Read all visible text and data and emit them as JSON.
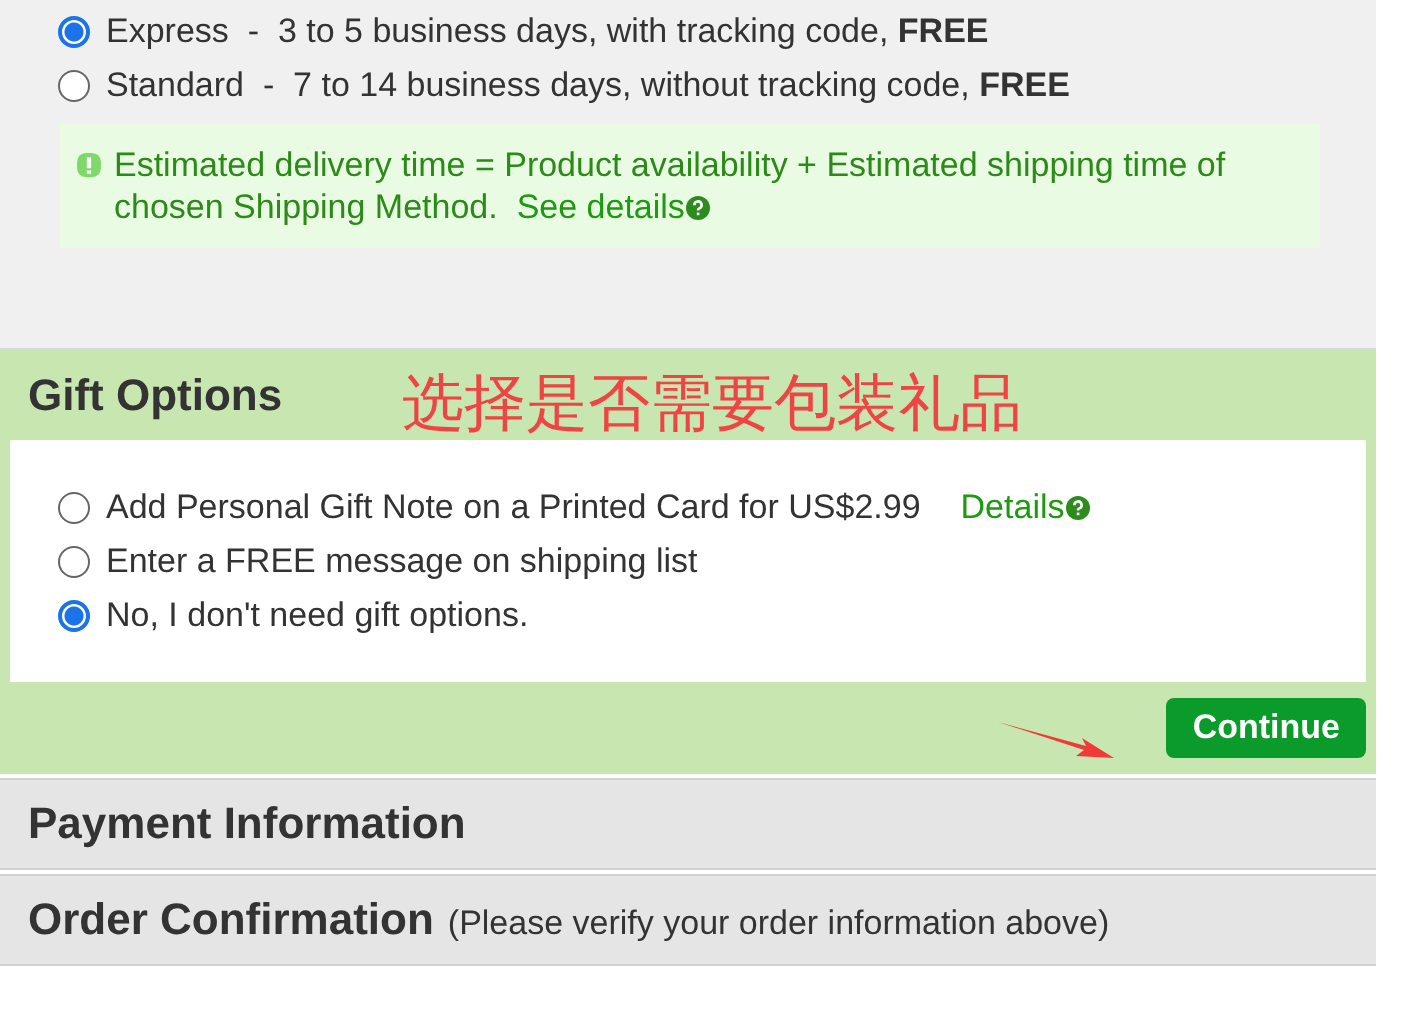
{
  "shipping_methods": [
    {
      "text": "Express  -  3 to 5 business days, with tracking code, **FREE**",
      "selected": true
    },
    {
      "text": "Standard  -  7 to 14 business days, without tracking code, **FREE**",
      "selected": false
    }
  ],
  "shipping_note": {
    "text": "Estimated delivery time = Product availability + Estimated shipping time of chosen Shipping Method.",
    "link": "See details"
  },
  "gift_options": {
    "title": "Gift Options",
    "annotation": "选择是否需要包装礼品",
    "options": [
      {
        "label": "Add Personal Gift Note on a Printed Card for US$2.99",
        "link": "Details",
        "selected": false
      },
      {
        "label": "Enter a FREE message on shipping list",
        "selected": false
      },
      {
        "label": "No, I don't need gift options.",
        "selected": true
      }
    ],
    "button": "Continue"
  },
  "sections": [
    {
      "title": "Payment Information"
    },
    {
      "title": "Order Confirmation",
      "note": "(Please verify your order information above)"
    }
  ]
}
